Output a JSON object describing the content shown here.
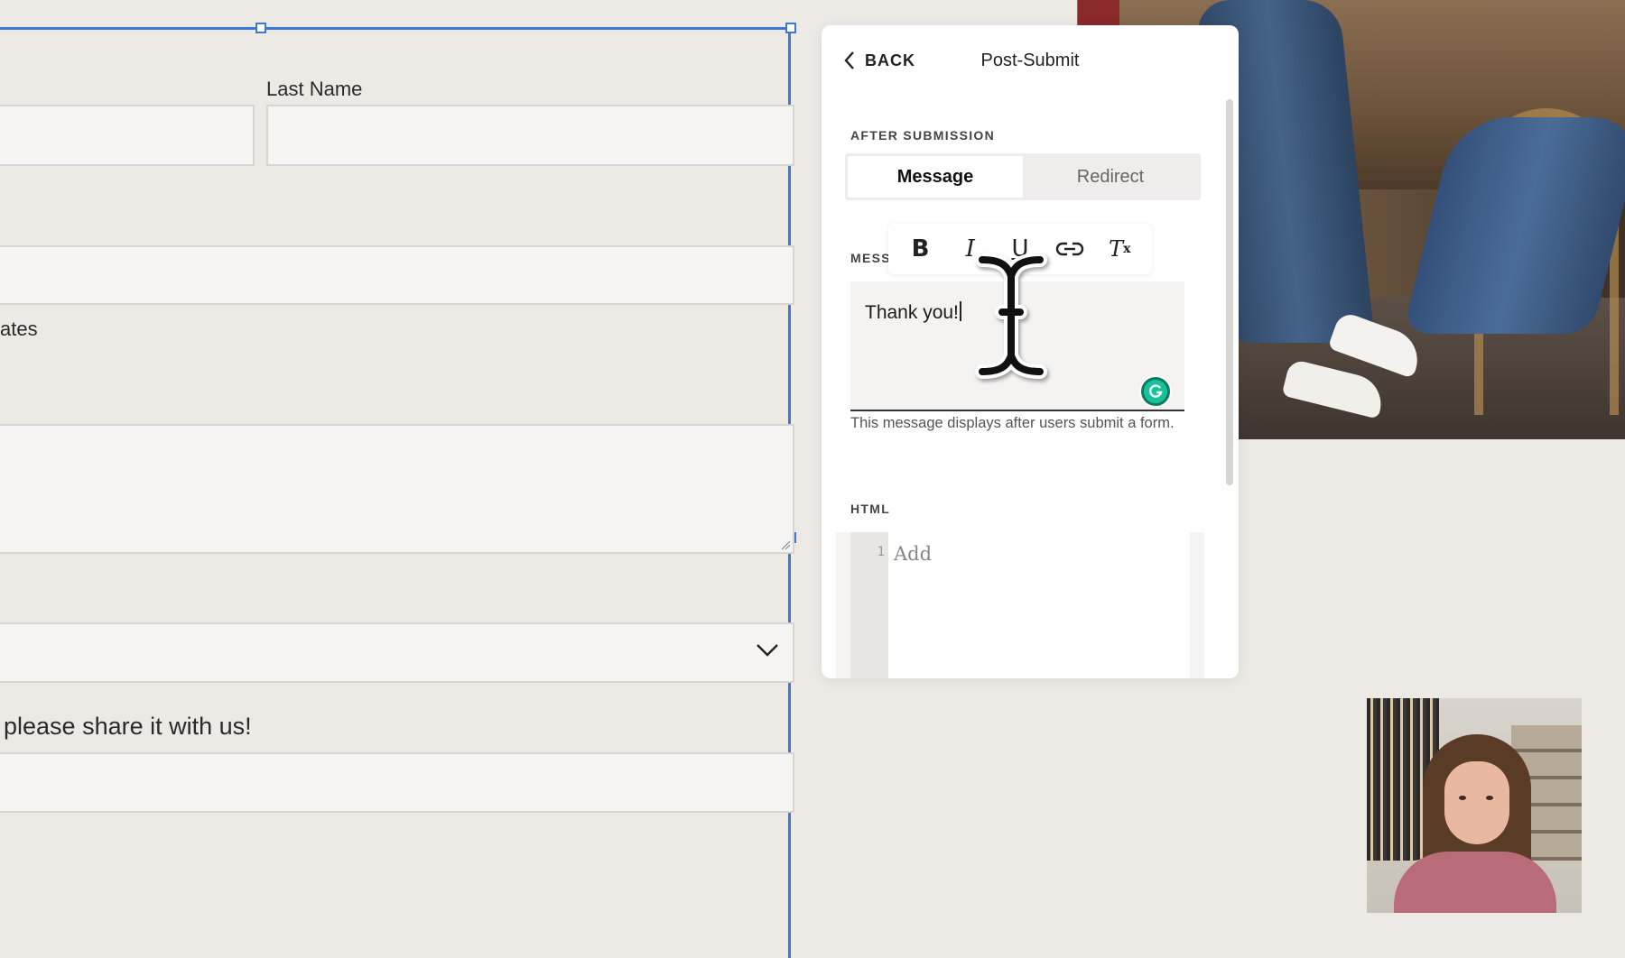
{
  "form": {
    "last_name_label": "Last Name",
    "updates_label": "ates",
    "share_label": "please share it with us!"
  },
  "panel": {
    "back_label": "BACK",
    "title": "Post-Submit",
    "after_submission_label": "AFTER SUBMISSION",
    "segmented": {
      "options": [
        "Message",
        "Redirect"
      ],
      "selected": "Message"
    },
    "message_label": "MESS",
    "toolbar": {
      "bold": "B",
      "italic": "I",
      "underline": "U",
      "clear": "T",
      "clear_sub": "x"
    },
    "editor_text": "Thank you!",
    "hint": "This message displays after users submit a form.",
    "html_label": "HTML",
    "code": {
      "line_number": "1",
      "placeholder": "Add"
    }
  },
  "colors": {
    "selection": "#3a79d8",
    "grammarly": "#15c39a",
    "background": "#edeae6"
  },
  "icons": [
    "chevron-left-icon",
    "bold-icon",
    "italic-icon",
    "underline-icon",
    "link-icon",
    "clear-format-icon",
    "grammarly-icon",
    "chevron-down-icon",
    "text-cursor-icon"
  ]
}
